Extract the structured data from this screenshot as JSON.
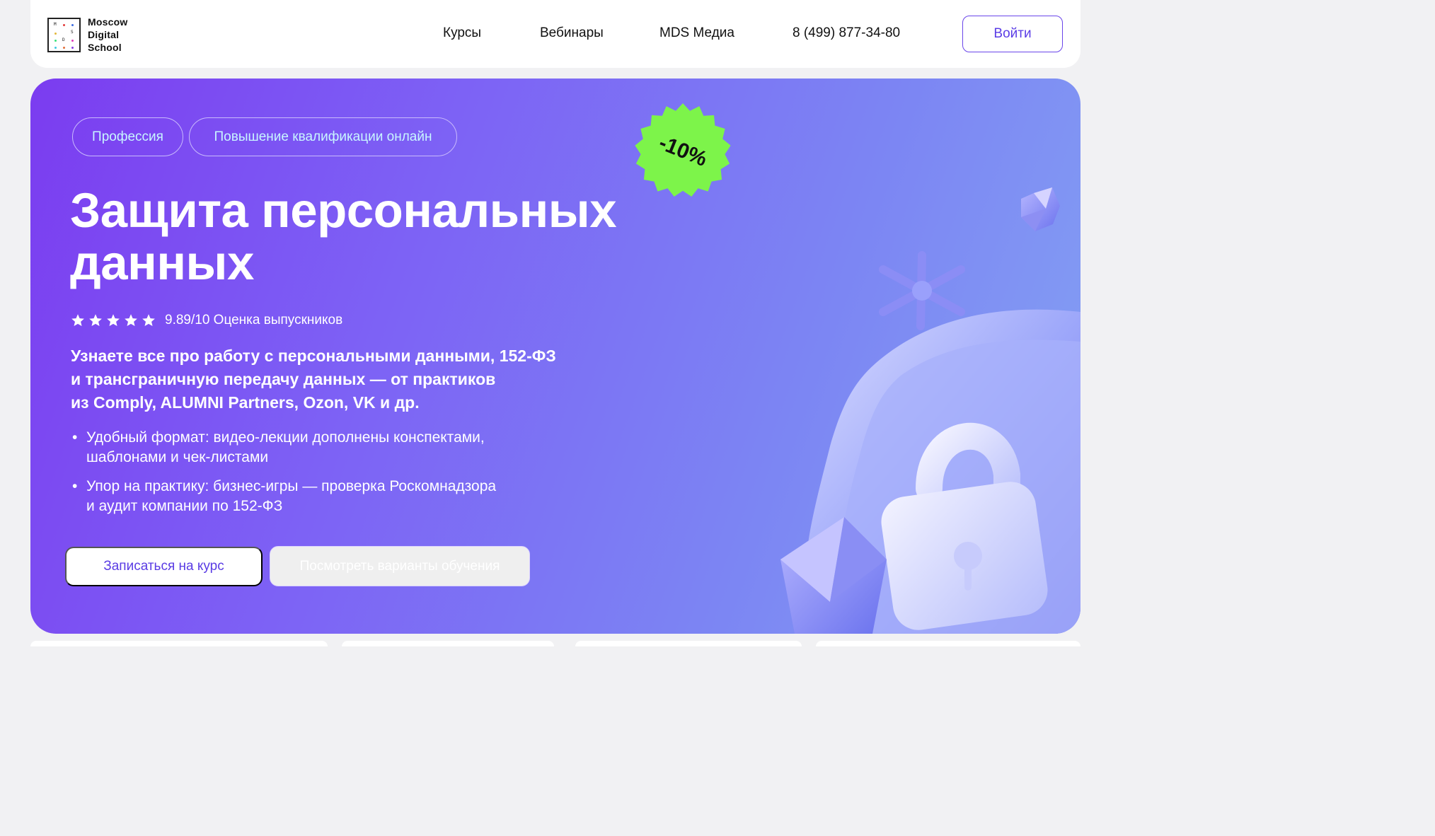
{
  "header": {
    "logo_lines": [
      "Moscow",
      "Digital",
      "School"
    ],
    "logo_letters": [
      "M",
      "S",
      "D"
    ],
    "nav": [
      "Курсы",
      "Вебинары",
      "MDS Медиа"
    ],
    "phone": "8 (499) 877-34-80",
    "login_label": "Войти"
  },
  "hero": {
    "tags": [
      "Профессия",
      "Повышение квалификации онлайн"
    ],
    "badge": "-10%",
    "title_line1": "Защита персональных",
    "title_line2": "данных",
    "stars": 5,
    "rating_text": "9.89/10 Оценка выпускников",
    "subtitle_lines": [
      "Узнаете все про работу с персональными данными, 152-ФЗ",
      "и трансграничную передачу данных — от практиков",
      "из Comply, ALUMNI Partners, Ozon, VK и др."
    ],
    "bullets": [
      {
        "line1": "Удобный формат: видео-лекции дополнены конспектами,",
        "line2": "шаблонами и чек-листами"
      },
      {
        "line1": "Упор на практику: бизнес-игры — проверка Роскомнадзора",
        "line2": "и аудит компании по 152-ФЗ"
      }
    ],
    "primary_button": "Записаться на курс",
    "secondary_button": "Посмотреть варианты обучения"
  },
  "colors": {
    "accent": "#5b3de6",
    "badge_green": "#7df44a",
    "hero_gradient_start": "#7b3cf0",
    "hero_gradient_end": "#84a2f3"
  },
  "icons": [
    "logo-icon",
    "star-icon",
    "discount-badge-icon",
    "lock-shield-illustration",
    "crystal-icon"
  ]
}
